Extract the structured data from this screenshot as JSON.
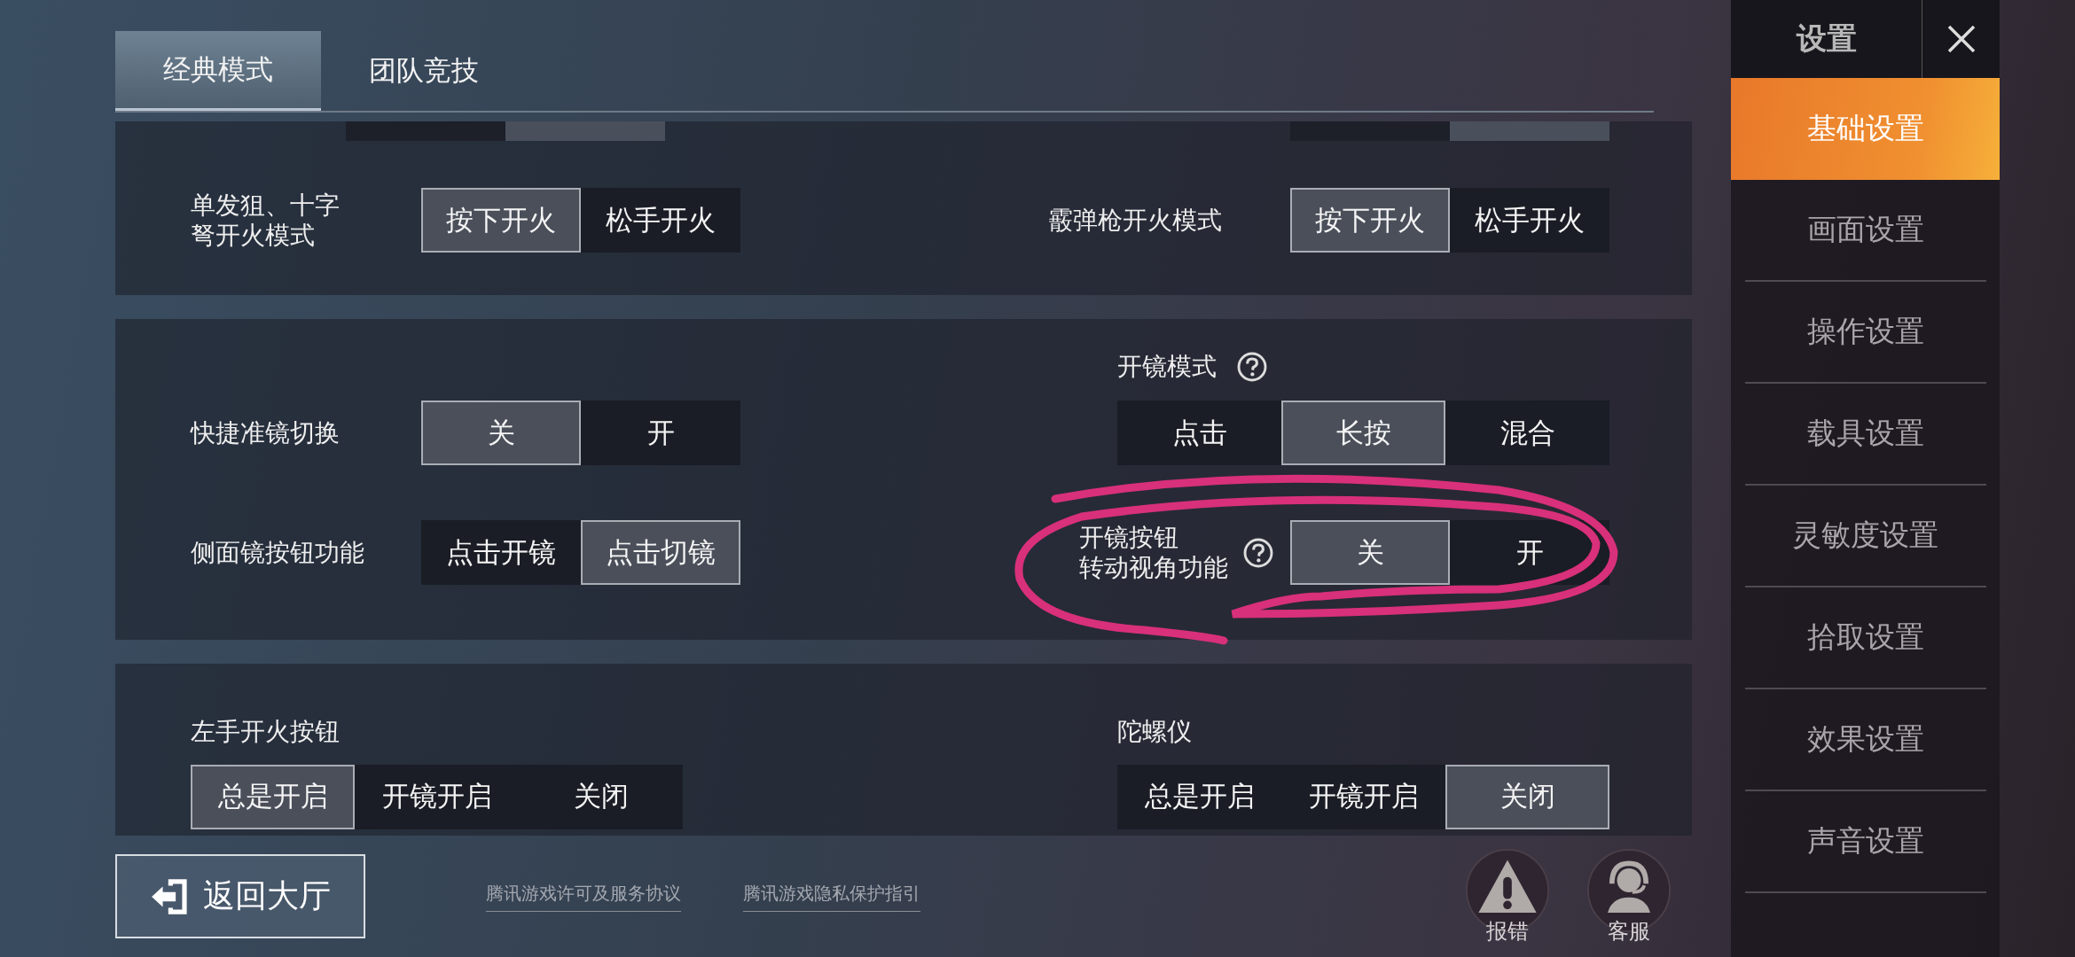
{
  "tabs": [
    {
      "label": "经典模式",
      "selected": true
    },
    {
      "label": "团队竞技",
      "selected": false
    }
  ],
  "panels": [
    {
      "cut_top": true,
      "rows": [
        [
          {
            "kind": "inline",
            "label": [
              "单发狙、十字",
              "弩开火模式"
            ],
            "help": false,
            "options": [
              {
                "label": "按下开火",
                "selected": true
              },
              {
                "label": "松手开火",
                "selected": false
              }
            ]
          },
          {
            "kind": "inline",
            "label": [
              "霰弹枪开火模式"
            ],
            "help": false,
            "options": [
              {
                "label": "按下开火",
                "selected": true
              },
              {
                "label": "松手开火",
                "selected": false
              }
            ]
          }
        ]
      ]
    },
    {
      "cut_top": false,
      "rows": [
        [
          {
            "kind": "inline",
            "label": [
              "快捷准镜切换"
            ],
            "help": false,
            "options": [
              {
                "label": "关",
                "selected": true
              },
              {
                "label": "开",
                "selected": false
              }
            ]
          },
          {
            "kind": "stacked",
            "label": [
              "开镜模式"
            ],
            "help": true,
            "options": [
              {
                "label": "点击",
                "selected": false
              },
              {
                "label": "长按",
                "selected": true
              },
              {
                "label": "混合",
                "selected": false
              }
            ]
          }
        ],
        [
          {
            "kind": "inline",
            "label": [
              "侧面镜按钮功能"
            ],
            "help": false,
            "options": [
              {
                "label": "点击开镜",
                "selected": false
              },
              {
                "label": "点击切镜",
                "selected": true
              }
            ]
          },
          {
            "kind": "inline",
            "label": [
              "开镜按钮",
              "转动视角功能"
            ],
            "help": true,
            "options": [
              {
                "label": "关",
                "selected": true
              },
              {
                "label": "开",
                "selected": false
              }
            ]
          }
        ]
      ]
    },
    {
      "cut_top": false,
      "rows": [
        [
          {
            "kind": "stacked",
            "label": [
              "左手开火按钮"
            ],
            "help": false,
            "options": [
              {
                "label": "总是开启",
                "selected": true
              },
              {
                "label": "开镜开启",
                "selected": false
              },
              {
                "label": "关闭",
                "selected": false
              }
            ]
          },
          {
            "kind": "stacked",
            "label": [
              "陀螺仪"
            ],
            "help": false,
            "options": [
              {
                "label": "总是开启",
                "selected": false
              },
              {
                "label": "开镜开启",
                "selected": false
              },
              {
                "label": "关闭",
                "selected": true
              }
            ]
          }
        ]
      ]
    }
  ],
  "back_button": "返回大厅",
  "links": [
    "腾讯游戏许可及服务协议",
    "腾讯游戏隐私保护指引"
  ],
  "actions": [
    {
      "kind": "report",
      "label": "报错"
    },
    {
      "kind": "support",
      "label": "客服"
    }
  ],
  "sidebar": {
    "title": "设置",
    "items": [
      {
        "label": "基础设置",
        "selected": true
      },
      {
        "label": "画面设置",
        "selected": false
      },
      {
        "label": "操作设置",
        "selected": false
      },
      {
        "label": "载具设置",
        "selected": false
      },
      {
        "label": "灵敏度设置",
        "selected": false
      },
      {
        "label": "拾取设置",
        "selected": false
      },
      {
        "label": "效果设置",
        "selected": false
      },
      {
        "label": "声音设置",
        "selected": false
      }
    ]
  }
}
